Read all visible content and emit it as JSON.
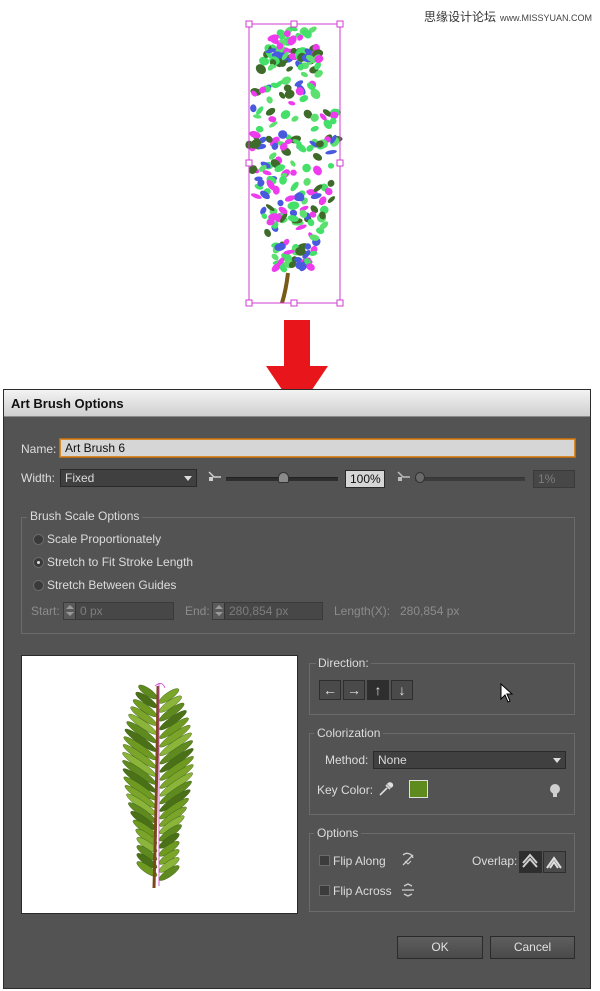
{
  "watermark": {
    "text": "思缘设计论坛",
    "site": "www.MISSYUAN.COM"
  },
  "dialog": {
    "title": "Art Brush Options",
    "name": {
      "label": "Name:",
      "value": "Art Brush 6"
    },
    "width": {
      "label": "Width:",
      "selected": "Fixed",
      "percent": "100%",
      "min_percent": "1%"
    },
    "scale_options": {
      "title": "Brush Scale Options",
      "options": [
        "Scale Proportionately",
        "Stretch to Fit Stroke Length",
        "Stretch Between Guides"
      ],
      "selected_index": 1,
      "start_label": "Start:",
      "start_value": "0 px",
      "end_label": "End:",
      "end_value": "280,854 px",
      "length_label": "Length(X):",
      "length_value": "280,854 px"
    },
    "direction": {
      "title": "Direction:",
      "buttons": [
        "←",
        "→",
        "↑",
        "↓"
      ],
      "selected_index": 2
    },
    "colorization": {
      "title": "Colorization",
      "method_label": "Method:",
      "method_value": "None",
      "key_color_label": "Key Color:",
      "key_color": "#5e8a1e"
    },
    "options": {
      "title": "Options",
      "flip_along": "Flip Along",
      "flip_across": "Flip Across",
      "overlap_label": "Overlap:"
    },
    "buttons": {
      "ok": "OK",
      "cancel": "Cancel"
    }
  },
  "colors": {
    "arrow": "#e8161b",
    "dialog_bg": "#535353",
    "selection": "#d13bd1"
  }
}
